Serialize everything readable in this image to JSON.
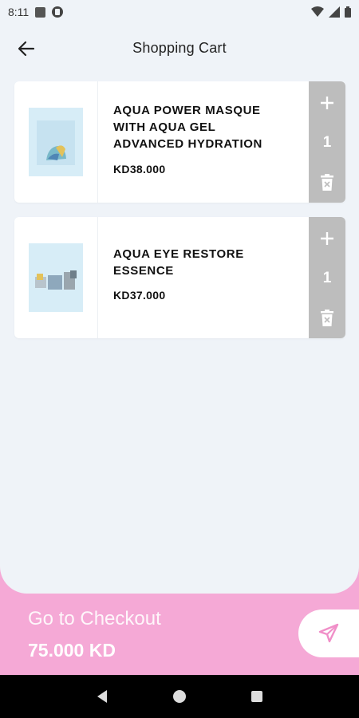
{
  "status_bar": {
    "time": "8:11"
  },
  "header": {
    "title": "Shopping Cart"
  },
  "cart": {
    "items": [
      {
        "name": "AQUA POWER MASQUE WITH AQUA GEL ADVANCED HYDRATION",
        "price": "KD38.000",
        "quantity": "1"
      },
      {
        "name": "AQUA EYE RESTORE ESSENCE",
        "price": "KD37.000",
        "quantity": "1"
      }
    ]
  },
  "checkout": {
    "label": "Go to Checkout",
    "total": "75.000 KD"
  },
  "colors": {
    "accent_pink": "#f5a9d6",
    "background": "#eff3f8",
    "qty_panel": "#bdbdbd",
    "gear": "#7a8597"
  },
  "icons": [
    "back-arrow-icon",
    "gear-icon",
    "plus-icon",
    "trash-icon",
    "send-icon"
  ]
}
